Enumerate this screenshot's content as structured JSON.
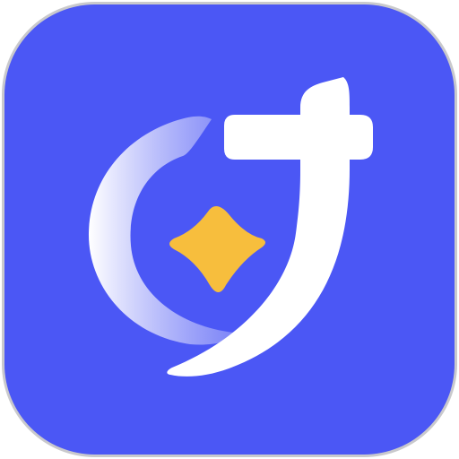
{
  "icon": {
    "name": "app-icon",
    "shape": "rounded-square",
    "logo": "stylized-c-j-monogram-with-star",
    "colors": {
      "frame": "#c9c9cc",
      "background": "#4b57f5",
      "logo": "#ffffff",
      "star": "#f7be3d",
      "swoosh_fade": "#c9cbfb"
    }
  }
}
